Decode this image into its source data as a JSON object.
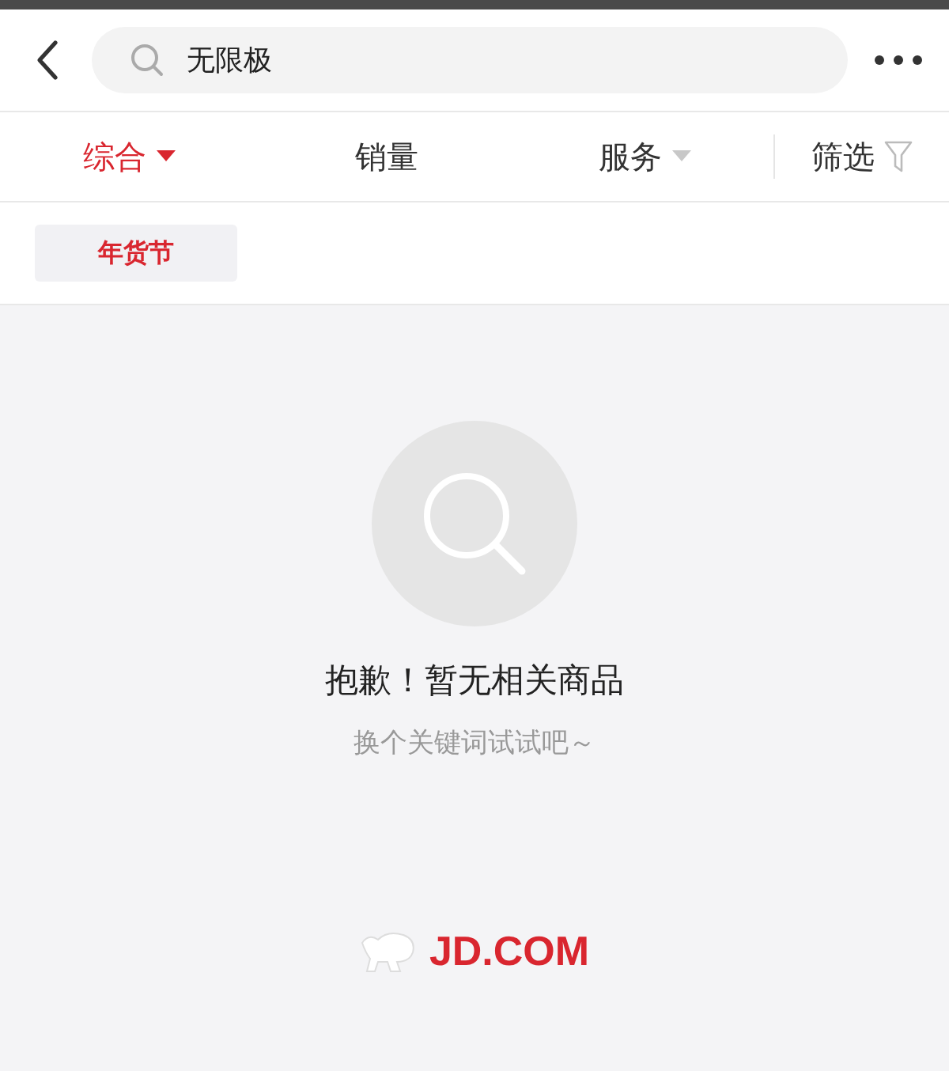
{
  "search": {
    "value": "无限极"
  },
  "sort_tabs": [
    {
      "label": "综合",
      "kind": "dropdown",
      "selected": true
    },
    {
      "label": "销量",
      "kind": "plain",
      "selected": false
    },
    {
      "label": "服务",
      "kind": "dropdown",
      "selected": false
    },
    {
      "label": "筛选",
      "kind": "filter",
      "selected": false
    }
  ],
  "tags": [
    {
      "label": "年货节"
    }
  ],
  "empty_state": {
    "title": "抱歉！暂无相关商品",
    "hint": "换个关键词试试吧～"
  },
  "footer_logo": {
    "text": "JD.COM"
  }
}
